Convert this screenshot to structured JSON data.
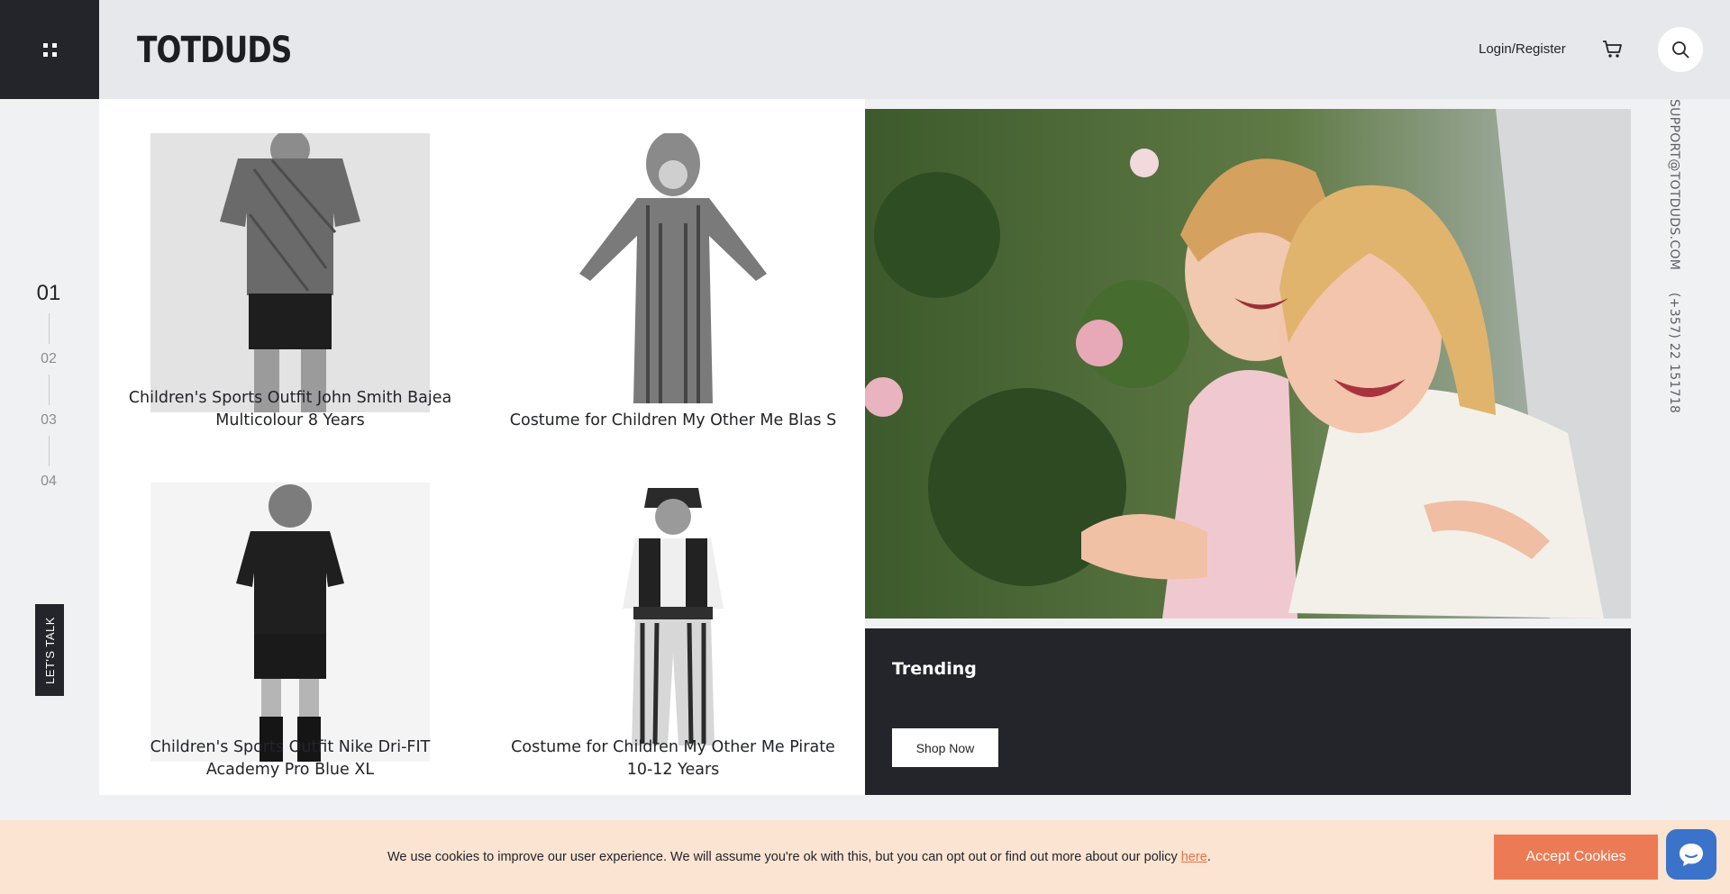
{
  "brand": {
    "name": "TOTDUDS",
    "logo_icon": "kids-logo-icon"
  },
  "header": {
    "login_label": "Login/Register",
    "cart_icon": "cart-icon",
    "search_icon": "search-icon",
    "menu_icon": "grid-menu-icon"
  },
  "pager": {
    "items": [
      "01",
      "02",
      "03",
      "04"
    ],
    "active": "01"
  },
  "lets_talk": "LET'S TALK",
  "products": [
    {
      "title": "Children's Sports Outfit John Smith Bajea Multicolour 8 Years"
    },
    {
      "title": "Costume for Children My Other Me Blas S"
    },
    {
      "title": "Children's Sports Outfit Nike Dri-FIT Academy Pro Blue XL"
    },
    {
      "title": "Costume for Children My Other Me Pirate 10-12 Years"
    }
  ],
  "trend": {
    "title": "Trending",
    "subtitle": "",
    "button_label": "Shop Now"
  },
  "contact": {
    "email": "SUPPORT@TOTDUDS.COM",
    "phone": "(+357) 22 151718"
  },
  "cookie": {
    "text_before": "We use cookies to improve our user experience. We will assume you're ok with this, but you can opt out or find out more about our policy ",
    "link_label": "here",
    "text_after": ".",
    "accept_label": "Accept Cookies"
  },
  "colors": {
    "dark": "#23252b",
    "accent": "#ec7a55",
    "cookie_bg": "#fce4d2",
    "chat": "#3a73c9"
  }
}
